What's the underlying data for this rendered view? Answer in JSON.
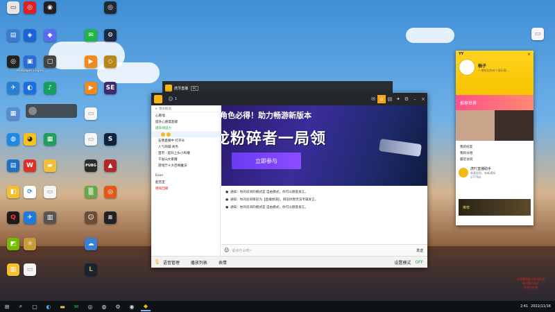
{
  "desktop": {
    "icons": [
      {
        "label": "",
        "color": "#e7e7e7",
        "glyph": "",
        "x": 0
      },
      {
        "label": "网易云",
        "color": "#e02020",
        "glyph": "◎"
      },
      {
        "label": "OBS",
        "color": "#1e1e1e",
        "glyph": "◉"
      },
      {
        "label": "",
        "color": "#2f2f2f",
        "glyph": "◎"
      }
    ],
    "partial_label_center": "Wallpaper Engine",
    "edge_label": "YY"
  },
  "huya": {
    "top_title": "虎牙直播",
    "badge": "PC",
    "online_count": "1",
    "left_tree": {
      "search_label": "添加频道",
      "sections": [
        "心愿墙",
        "提升心愿度超级",
        "提升阅读力",
        "石牌直播中 打开头",
        "人气商城·商务",
        "首页 · 提升上头小布播",
        "千层山大家播",
        "游戏厅十大召唤魔法",
        "Econ",
        "配音室",
        "继续回播"
      ]
    },
    "banner": {
      "subtitle": "角色必得！助力畅游新版本",
      "headline": "龙粉碎者一局领",
      "cta": "立即参与"
    },
    "chat": {
      "lines": [
        "通知：你的房间的模式是 自由模式，你可以随意发言。",
        "通知：你的房间目前为【直播频道】，目前你暂无法专属发言。",
        "通知：你的房间的模式是 自由模式，你可以随意发言。"
      ],
      "input_placeholder": "说点什么吧~",
      "send": "发送"
    },
    "bottom": {
      "items": [
        "语音管理",
        "播放列表",
        "表情"
      ],
      "right_items": [
        "设置模式",
        "OFF"
      ]
    }
  },
  "yy_panel": {
    "title": "YY",
    "nickname": "柚子",
    "signature": "~ 哪些比你对人很乐观...",
    "section": "推荐世界",
    "tabs": [
      "我的好友",
      "我的分组",
      "最近访问"
    ],
    "recent_item": "虎吖直播助手",
    "recent_sub": "恭喜发财，有新通知",
    "recent_meta": "177784",
    "mini_banner": "推荐"
  },
  "taskbar": {
    "time": "2:41",
    "date": "2022/11/16"
  },
  "overlay": {
    "corner_text": "本直播间禁止乱喷乱说\n有问题可私信\n交流与反馈"
  }
}
